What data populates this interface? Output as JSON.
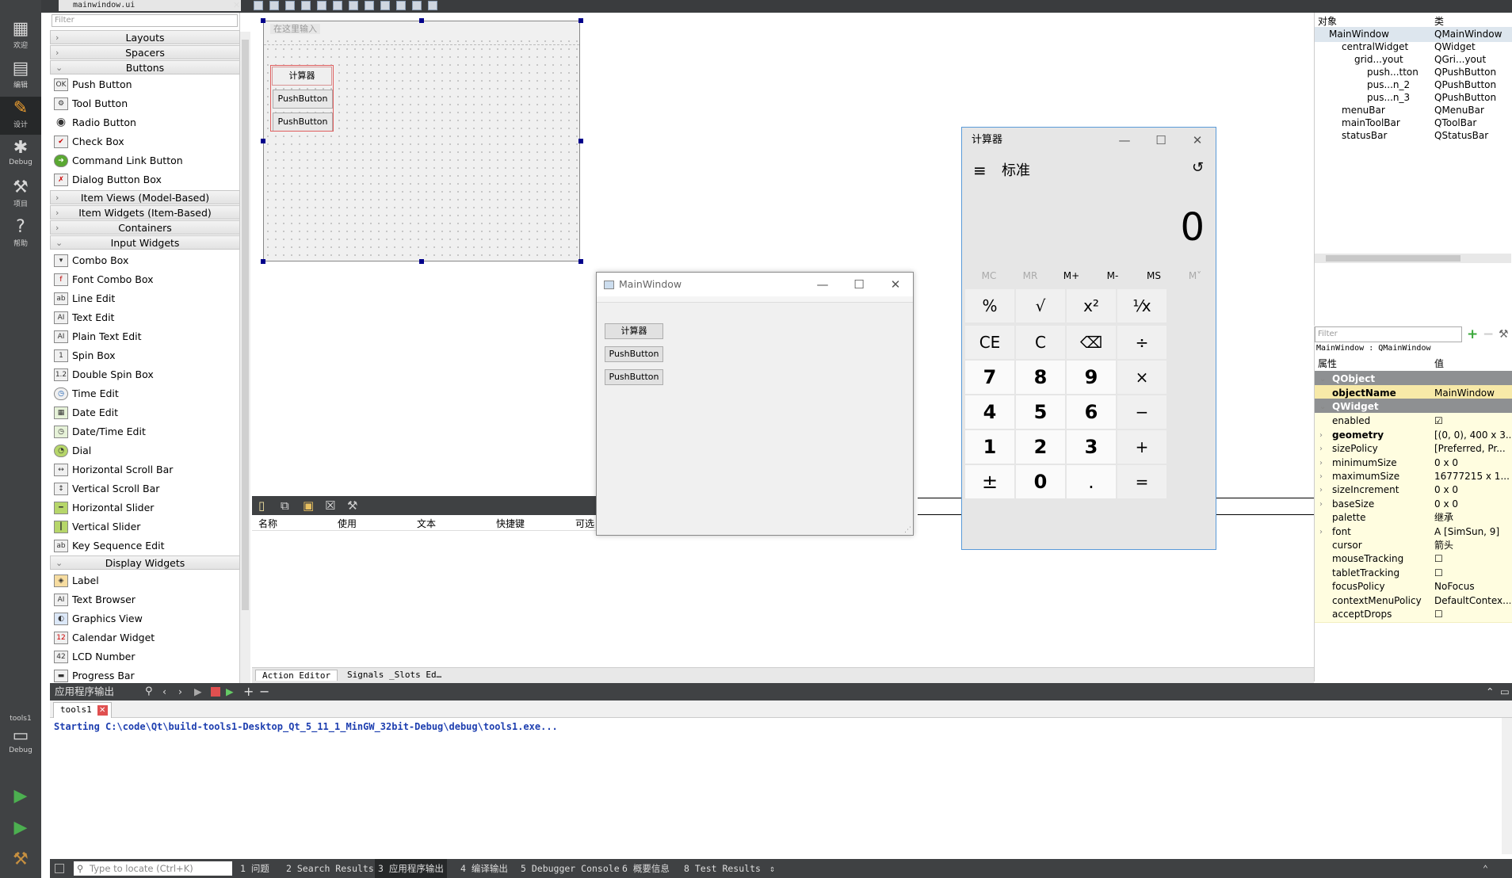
{
  "topbar": {
    "file_tab": "mainwindow.ui"
  },
  "modes": [
    {
      "label": "欢迎",
      "icon": "grid-icon"
    },
    {
      "label": "编辑",
      "icon": "document-icon"
    },
    {
      "label": "设计",
      "icon": "pencil-icon"
    },
    {
      "label": "Debug",
      "icon": "bug-icon"
    },
    {
      "label": "项目",
      "icon": "wrench-icon"
    },
    {
      "label": "帮助",
      "icon": "help-icon"
    }
  ],
  "kit": {
    "name": "tools1",
    "mode": "Debug"
  },
  "widgetbox": {
    "filter_placeholder": "Filter",
    "categories": {
      "layouts": "Layouts",
      "spacers": "Spacers",
      "buttons": "Buttons",
      "item_views": "Item Views (Model-Based)",
      "item_widgets": "Item Widgets (Item-Based)",
      "containers": "Containers",
      "input_widgets": "Input Widgets",
      "display_widgets": "Display Widgets"
    },
    "buttons": [
      "Push Button",
      "Tool Button",
      "Radio Button",
      "Check Box",
      "Command Link Button",
      "Dialog Button Box"
    ],
    "inputs": [
      "Combo Box",
      "Font Combo Box",
      "Line Edit",
      "Text Edit",
      "Plain Text Edit",
      "Spin Box",
      "Double Spin Box",
      "Time Edit",
      "Date Edit",
      "Date/Time Edit",
      "Dial",
      "Horizontal Scroll Bar",
      "Vertical Scroll Bar",
      "Horizontal Slider",
      "Vertical Slider",
      "Key Sequence Edit"
    ],
    "displays": [
      "Label",
      "Text Browser",
      "Graphics View",
      "Calendar Widget",
      "LCD Number",
      "Progress Bar"
    ]
  },
  "form": {
    "menu_placeholder": "在这里输入",
    "buttons": [
      "计算器",
      "PushButton",
      "PushButton"
    ]
  },
  "action_editor": {
    "columns": [
      "名称",
      "使用",
      "文本",
      "快捷键",
      "可选的"
    ],
    "tabs": [
      "Action Editor",
      "Signals _Slots Ed…"
    ]
  },
  "mainwindow": {
    "title": "MainWindow",
    "buttons": [
      "计算器",
      "PushButton",
      "PushButton"
    ]
  },
  "calculator": {
    "title": "计算器",
    "mode": "标准",
    "display": "0",
    "memory": [
      "MC",
      "MR",
      "M+",
      "M-",
      "MS",
      "M˅"
    ],
    "keys": [
      "%",
      "√",
      "x²",
      "¹⁄x",
      "CE",
      "C",
      "⌫",
      "÷",
      "7",
      "8",
      "9",
      "×",
      "4",
      "5",
      "6",
      "−",
      "1",
      "2",
      "3",
      "+",
      "±",
      "0",
      ".",
      "="
    ]
  },
  "object_inspector": {
    "headers": [
      "对象",
      "类"
    ],
    "rows": [
      {
        "name": "MainWindow",
        "cls": "QMainWindow"
      },
      {
        "name": "centralWidget",
        "cls": "QWidget"
      },
      {
        "name": "grid...yout",
        "cls": "QGri...yout"
      },
      {
        "name": "push...tton",
        "cls": "QPushButton"
      },
      {
        "name": "pus...n_2",
        "cls": "QPushButton"
      },
      {
        "name": "pus...n_3",
        "cls": "QPushButton"
      },
      {
        "name": "menuBar",
        "cls": "QMenuBar"
      },
      {
        "name": "mainToolBar",
        "cls": "QToolBar"
      },
      {
        "name": "statusBar",
        "cls": "QStatusBar"
      }
    ]
  },
  "property_editor": {
    "filter_placeholder": "Filter",
    "class_line": "MainWindow : QMainWindow",
    "headers": [
      "属性",
      "值"
    ],
    "groups": [
      "QObject",
      "QWidget"
    ],
    "object_name": {
      "name": "objectName",
      "value": "MainWindow"
    },
    "rows": [
      {
        "name": "enabled",
        "value": "☑"
      },
      {
        "name": "geometry",
        "value": "[(0, 0), 400 x 3..."
      },
      {
        "name": "sizePolicy",
        "value": "[Preferred, Pr..."
      },
      {
        "name": "minimumSize",
        "value": "0 x 0"
      },
      {
        "name": "maximumSize",
        "value": "16777215 x 1..."
      },
      {
        "name": "sizeIncrement",
        "value": "0 x 0"
      },
      {
        "name": "baseSize",
        "value": "0 x 0"
      },
      {
        "name": "palette",
        "value": "继承"
      },
      {
        "name": "font",
        "value": "A [SimSun, 9]"
      },
      {
        "name": "cursor",
        "value": "箭头"
      },
      {
        "name": "mouseTracking",
        "value": "☐"
      },
      {
        "name": "tabletTracking",
        "value": "☐"
      },
      {
        "name": "focusPolicy",
        "value": "NoFocus"
      },
      {
        "name": "contextMenuPolicy",
        "value": "DefaultContex..."
      },
      {
        "name": "acceptDrops",
        "value": "☐"
      }
    ]
  },
  "output": {
    "pane_title": "应用程序输出",
    "tab": "tools1",
    "line": "Starting C:\\code\\Qt\\build-tools1-Desktop_Qt_5_11_1_MinGW_32bit-Debug\\debug\\tools1.exe..."
  },
  "statusbar": {
    "locate_placeholder": "Type to locate (Ctrl+K)",
    "tabs": [
      "1 问题",
      "2 Search Results",
      "3 应用程序输出",
      "4 编译输出",
      "5 Debugger Console",
      "6 概要信息",
      "8 Test Results"
    ]
  }
}
